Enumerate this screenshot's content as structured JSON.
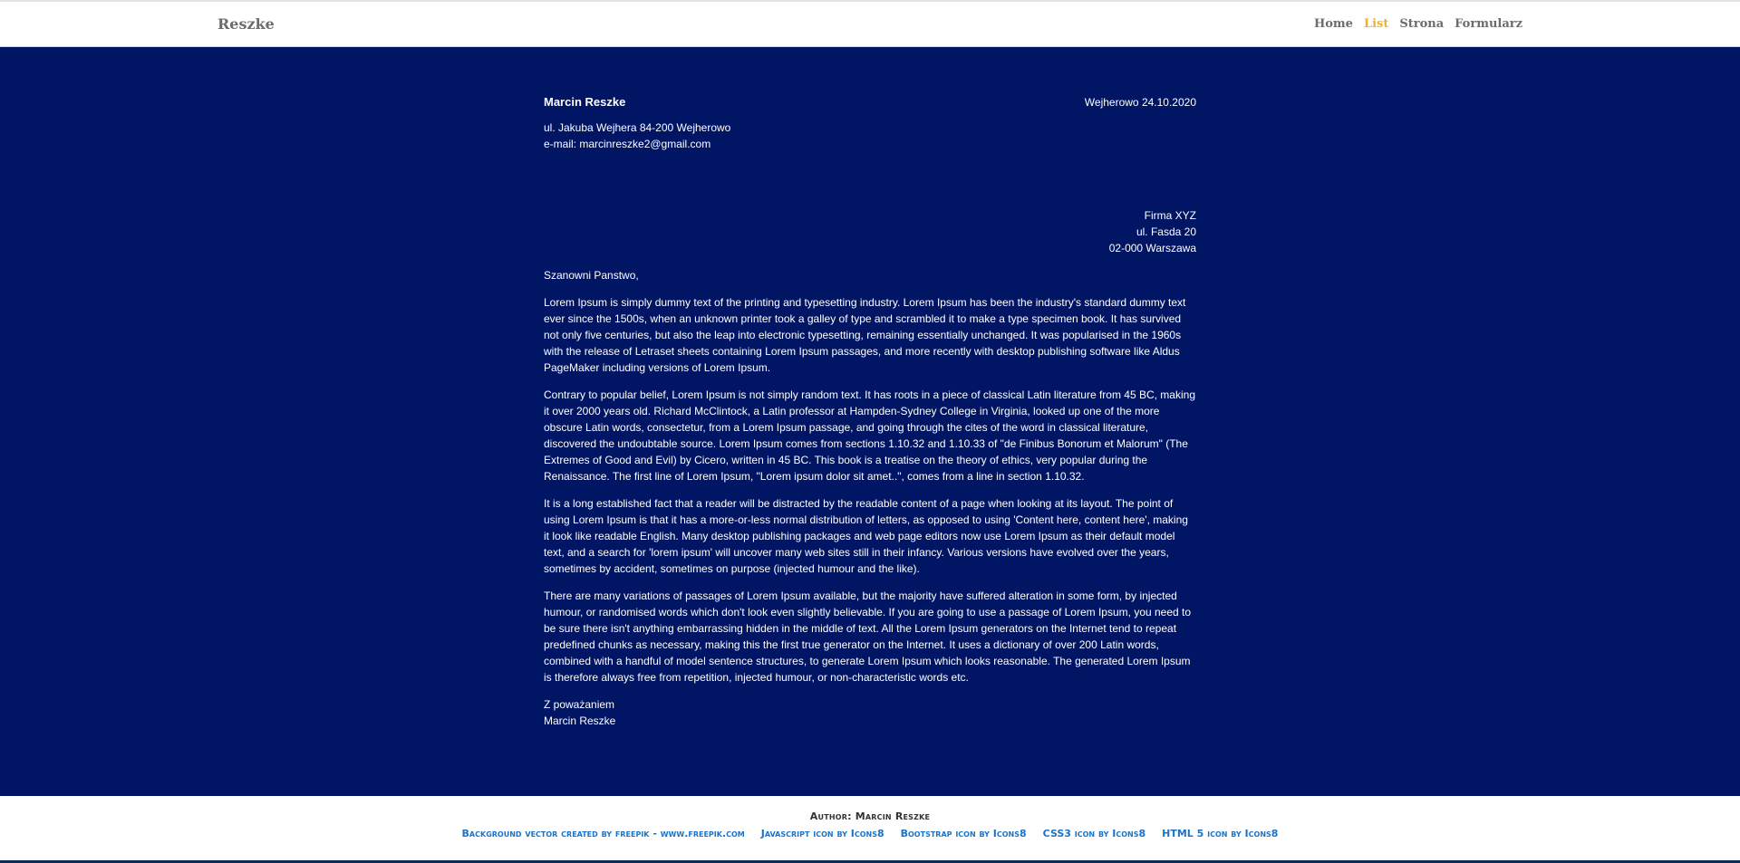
{
  "nav": {
    "brand": "Reszke",
    "items": [
      {
        "label": "Home",
        "active": false
      },
      {
        "label": "List",
        "active": true
      },
      {
        "label": "Strona",
        "active": false
      },
      {
        "label": "Formularz",
        "active": false
      }
    ]
  },
  "letter": {
    "sender_name": "Marcin Reszke",
    "place_date": "Wejherowo 24.10.2020",
    "sender_address": "ul. Jakuba Wejhera 84-200 Wejherowo",
    "sender_email": "e-mail: marcinreszke2@gmail.com",
    "recipient": {
      "company": "Firma XYZ",
      "street": "ul. Fasda 20",
      "city": "02-000 Warszawa"
    },
    "greeting": "Szanowni Panstwo,",
    "paragraphs": [
      "Lorem Ipsum is simply dummy text of the printing and typesetting industry. Lorem Ipsum has been the industry's standard dummy text ever since the 1500s, when an unknown printer took a galley of type and scrambled it to make a type specimen book. It has survived not only five centuries, but also the leap into electronic typesetting, remaining essentially unchanged. It was popularised in the 1960s with the release of Letraset sheets containing Lorem Ipsum passages, and more recently with desktop publishing software like Aldus PageMaker including versions of Lorem Ipsum.",
      "Contrary to popular belief, Lorem Ipsum is not simply random text. It has roots in a piece of classical Latin literature from 45 BC, making it over 2000 years old. Richard McClintock, a Latin professor at Hampden-Sydney College in Virginia, looked up one of the more obscure Latin words, consectetur, from a Lorem Ipsum passage, and going through the cites of the word in classical literature, discovered the undoubtable source. Lorem Ipsum comes from sections 1.10.32 and 1.10.33 of \"de Finibus Bonorum et Malorum\" (The Extremes of Good and Evil) by Cicero, written in 45 BC. This book is a treatise on the theory of ethics, very popular during the Renaissance. The first line of Lorem Ipsum, \"Lorem ipsum dolor sit amet..\", comes from a line in section 1.10.32.",
      "It is a long established fact that a reader will be distracted by the readable content of a page when looking at its layout. The point of using Lorem Ipsum is that it has a more-or-less normal distribution of letters, as opposed to using 'Content here, content here', making it look like readable English. Many desktop publishing packages and web page editors now use Lorem Ipsum as their default model text, and a search for 'lorem ipsum' will uncover many web sites still in their infancy. Various versions have evolved over the years, sometimes by accident, sometimes on purpose (injected humour and the like).",
      "There are many variations of passages of Lorem Ipsum available, but the majority have suffered alteration in some form, by injected humour, or randomised words which don't look even slightly believable. If you are going to use a passage of Lorem Ipsum, you need to be sure there isn't anything embarrassing hidden in the middle of text. All the Lorem Ipsum generators on the Internet tend to repeat predefined chunks as necessary, making this the first true generator on the Internet. It uses a dictionary of over 200 Latin words, combined with a handful of model sentence structures, to generate Lorem Ipsum which looks reasonable. The generated Lorem Ipsum is therefore always free from repetition, injected humour, or non-characteristic words etc."
    ],
    "closing": "Z poważaniem",
    "signature": "Marcin Reszke"
  },
  "footer": {
    "author": "Author: Marcin Reszke",
    "credits": [
      "Background vector created by freepik - www.freepik.com",
      "Javascript icon by Icons8",
      "Bootstrap icon by Icons8",
      "CSS3 icon by Icons8",
      "HTML 5 icon by Icons8"
    ]
  },
  "colors": {
    "main_background": "#001665",
    "nav_active": "#f0b323",
    "nav_link": "#6c6c6c",
    "footer_link": "#1a73c8"
  }
}
